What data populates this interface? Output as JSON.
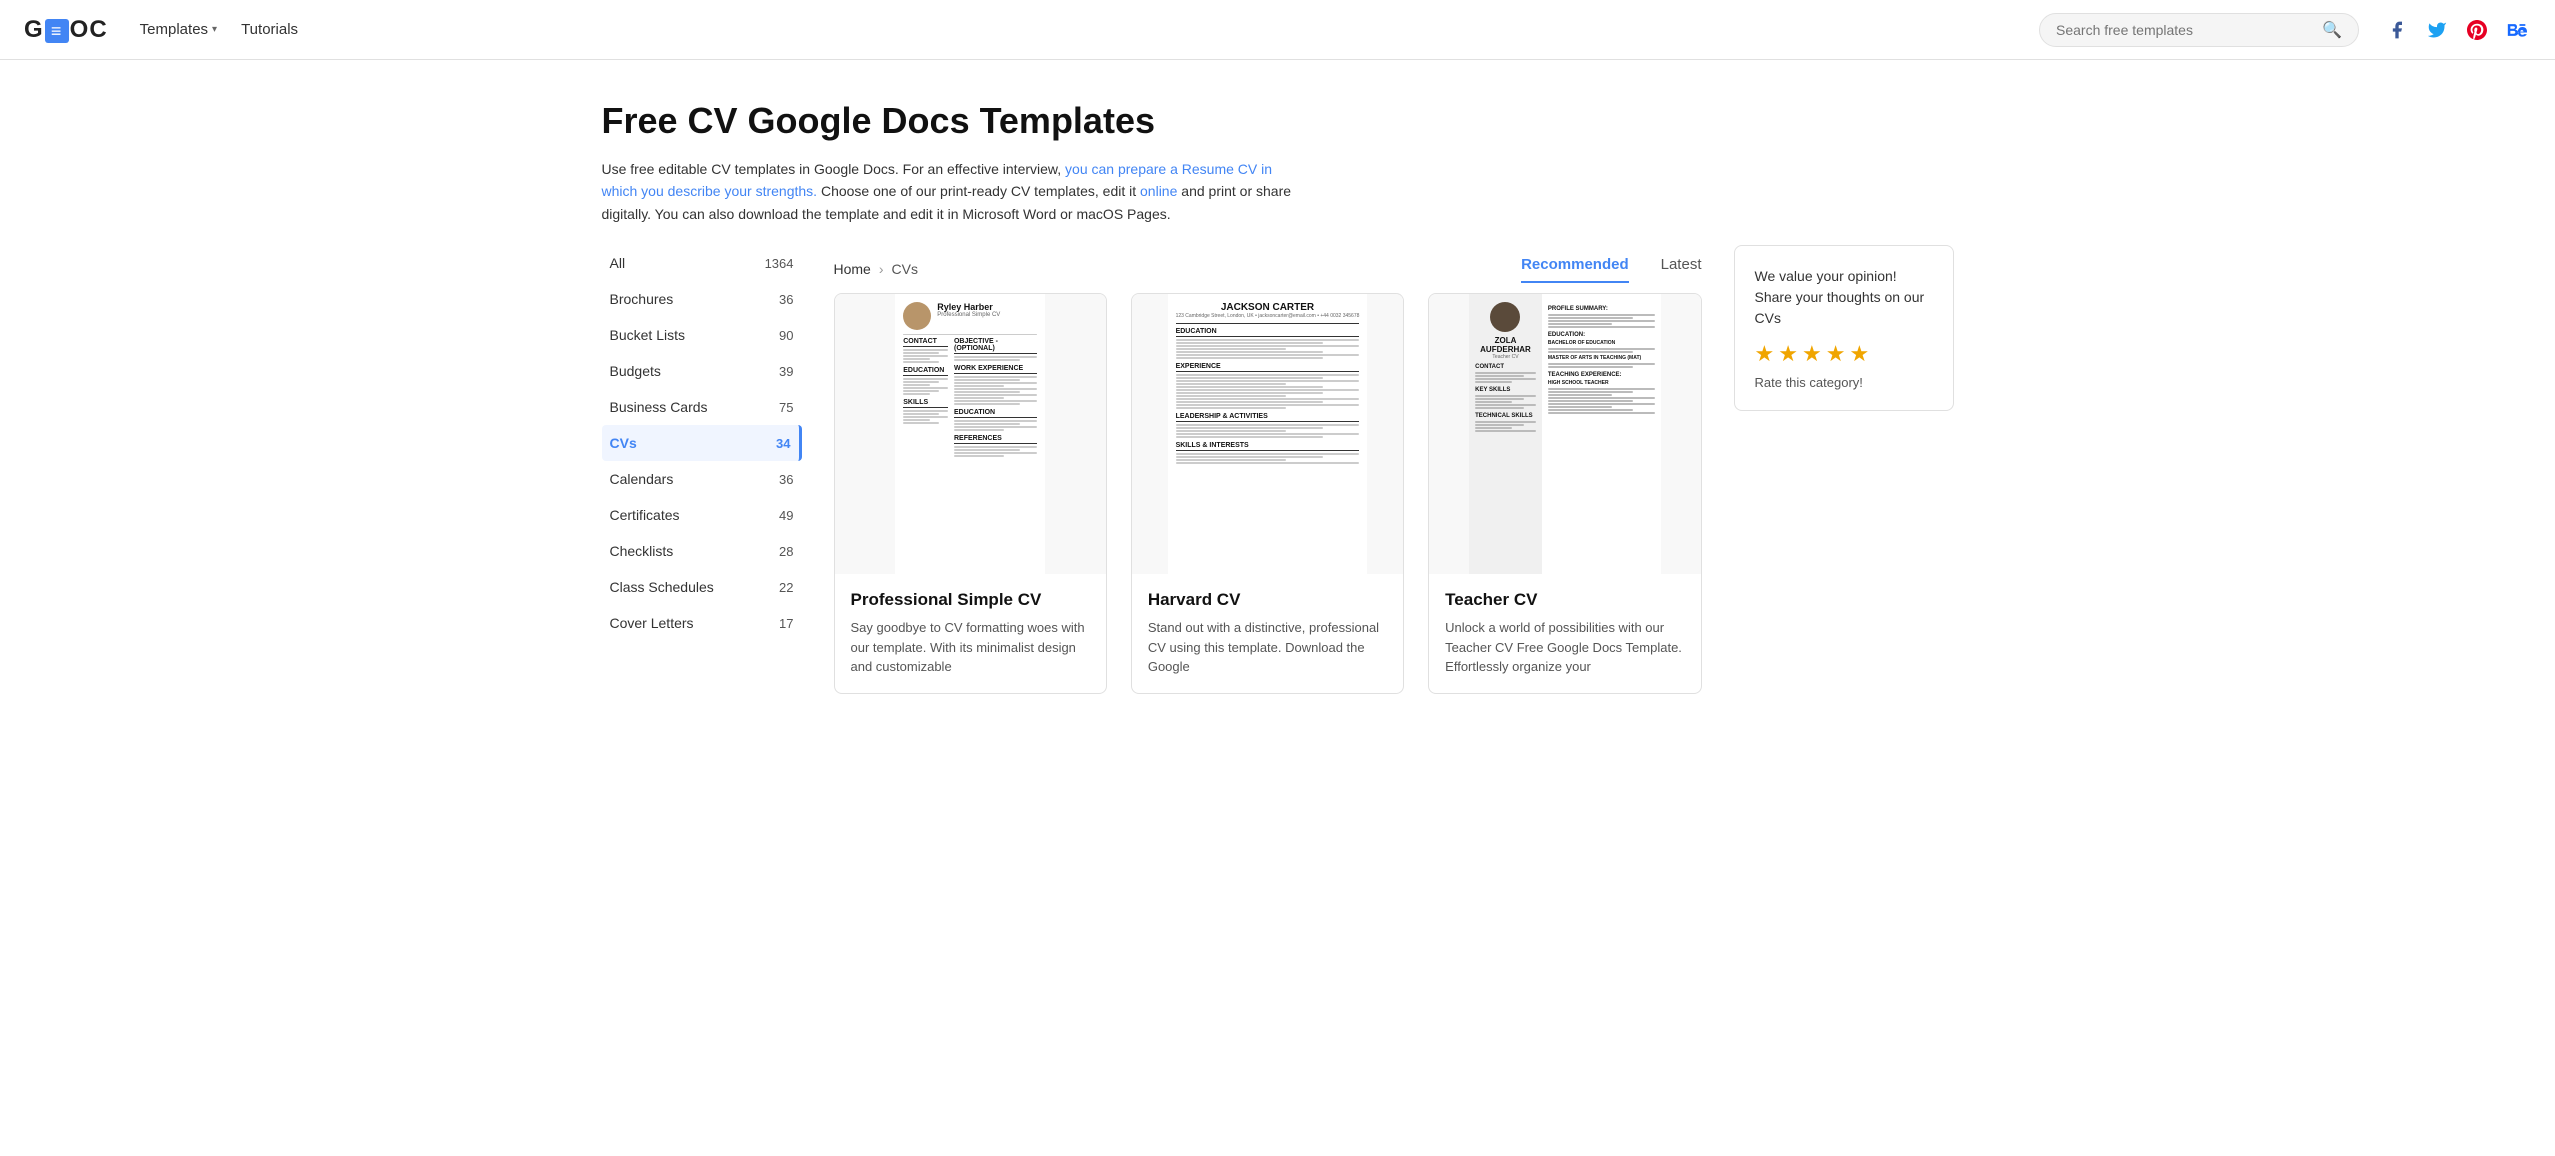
{
  "site": {
    "logo_g": "G",
    "logo_box": "≡",
    "logo_oc": "OC"
  },
  "nav": {
    "templates_label": "Templates",
    "tutorials_label": "Tutorials"
  },
  "search": {
    "placeholder": "Search free templates"
  },
  "social": {
    "facebook": "f",
    "twitter": "t",
    "pinterest": "P",
    "behance": "B"
  },
  "hero": {
    "title": "Free CV Google Docs Templates",
    "description": "Use free editable CV templates in Google Docs. For an effective interview, you can prepare a Resume CV in which you describe your strengths. Choose one of our print-ready CV templates, edit it online and print or share digitally. You can also download the template and edit it in Microsoft Word or macOS Pages."
  },
  "breadcrumb": {
    "home": "Home",
    "current": "CVs"
  },
  "sort_tabs": [
    {
      "label": "Recommended",
      "active": true
    },
    {
      "label": "Latest",
      "active": false
    }
  ],
  "sidebar": {
    "items": [
      {
        "label": "All",
        "count": "1364",
        "active": false
      },
      {
        "label": "Brochures",
        "count": "36",
        "active": false
      },
      {
        "label": "Bucket Lists",
        "count": "90",
        "active": false
      },
      {
        "label": "Budgets",
        "count": "39",
        "active": false
      },
      {
        "label": "Business Cards",
        "count": "75",
        "active": false
      },
      {
        "label": "CVs",
        "count": "34",
        "active": true
      },
      {
        "label": "Calendars",
        "count": "36",
        "active": false
      },
      {
        "label": "Certificates",
        "count": "49",
        "active": false
      },
      {
        "label": "Checklists",
        "count": "28",
        "active": false
      },
      {
        "label": "Class Schedules",
        "count": "22",
        "active": false
      },
      {
        "label": "Cover Letters",
        "count": "17",
        "active": false
      }
    ]
  },
  "rating": {
    "text": "We value your opinion! Share your thoughts on our CVs",
    "stars": [
      "★",
      "★",
      "★",
      "★",
      "★"
    ],
    "label": "Rate this category!"
  },
  "templates": [
    {
      "name": "Professional Simple CV",
      "description": "Say goodbye to CV formatting woes with our template. With its minimalist design and customizable"
    },
    {
      "name": "Harvard CV",
      "description": "Stand out with a distinctive, professional CV using this template. Download the Google"
    },
    {
      "name": "Teacher CV",
      "description": "Unlock a world of possibilities with our Teacher CV Free Google Docs Template. Effortlessly organize your"
    }
  ]
}
